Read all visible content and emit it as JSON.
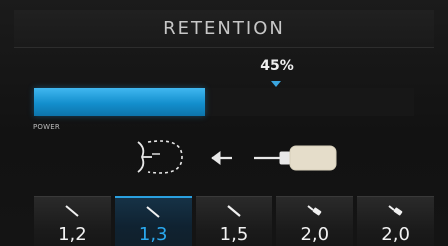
{
  "header": {
    "title": "RETENTION"
  },
  "power": {
    "label": "POWER",
    "percent_text": "45%",
    "level": 0.45,
    "accent_color": "#1a9ad8"
  },
  "diagram": {
    "icon": "tooth-retention-arrow-tip-icon"
  },
  "tips": [
    {
      "label": "1,2",
      "icon": "thin-tip-icon",
      "selected": false
    },
    {
      "label": "1,3",
      "icon": "thin-tip-icon",
      "selected": true
    },
    {
      "label": "1,5",
      "icon": "thin-tip-icon",
      "selected": false
    },
    {
      "label": "2,0",
      "icon": "wide-tip-icon",
      "selected": false
    },
    {
      "label": "2,0",
      "icon": "wide-tip-icon",
      "selected": false
    }
  ]
}
